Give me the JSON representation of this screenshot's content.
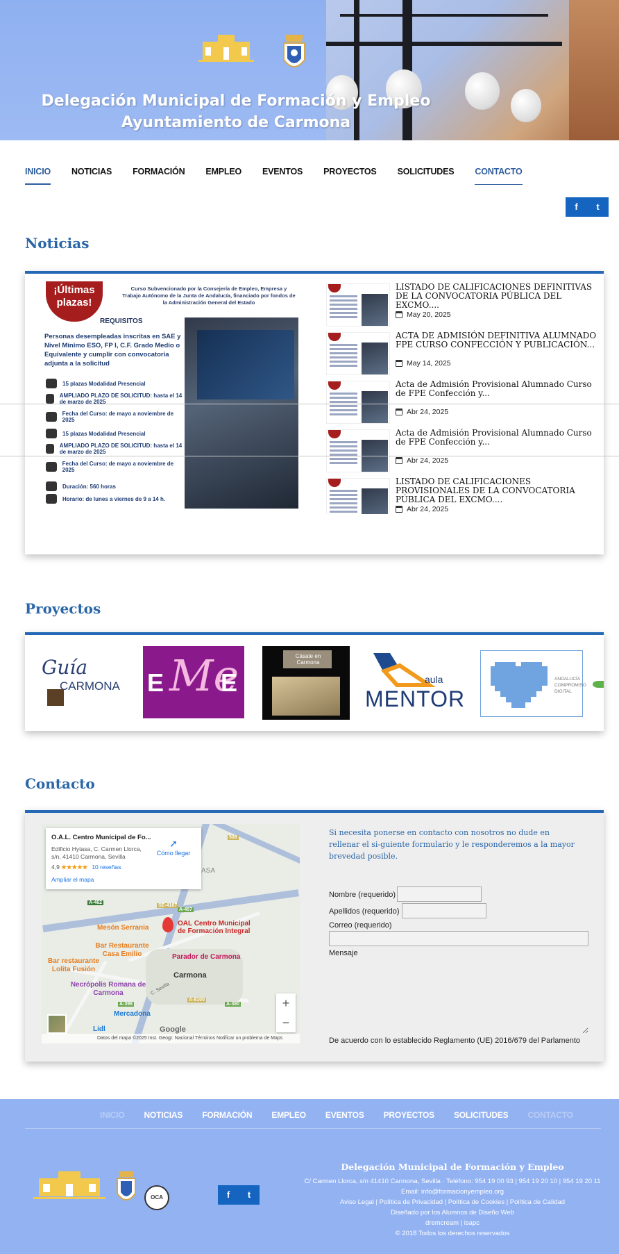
{
  "header": {
    "title_line1": "Delegación Municipal de Formación y Empleo",
    "title_line2": "Ayuntamiento de Carmona"
  },
  "nav": {
    "items": [
      "INICIO",
      "NOTICIAS",
      "FORMACIÓN",
      "EMPLEO",
      "EVENTOS",
      "PROYECTOS",
      "SOLICITUDES",
      "CONTACTO"
    ],
    "active": "INICIO"
  },
  "social": {
    "facebook": "f",
    "twitter": "t"
  },
  "noticias": {
    "heading": "Noticias",
    "featured": {
      "badge": "¡Últimas plazas!",
      "subtitle": "Curso Subvencionado por la Consejería de Empleo, Empresa y Trabajo Autónomo de la Junta de Andalucía, financiado por fondos de la Administración General del Estado",
      "requisitos": "REQUISITOS",
      "personas": "Personas desempleadas inscritas en SAE y Nivel Mínimo ESO, FP I, C.F. Grado Medio o Equivalente y cumplir con convocatoria adjunta a la solicitud",
      "rows": [
        "15 plazas Modalidad Presencial",
        "AMPLIADO PLAZO DE SOLICITUD: hasta el 14 de marzo de 2025",
        "Fecha del Curso: de mayo a noviembre de 2025",
        "15 plazas Modalidad Presencial",
        "AMPLIADO PLAZO DE SOLICITUD: hasta el 14 de marzo de 2025",
        "Fecha del Curso: de mayo a noviembre de 2025",
        "Duración: 560 horas",
        "Horario: de lunes a viernes de 9 a 14 h."
      ]
    },
    "items": [
      {
        "title": "LISTADO DE CALIFICACIONES DEFINITIVAS DE LA CONVOCATORIA PÚBLICA DEL EXCMO....",
        "date": "May 20, 2025"
      },
      {
        "title": "ACTA DE ADMISIÓN DEFINITIVA ALUMNADO FPE CURSO CONFECCIÓN Y PUBLICACIÓN...",
        "date": "May 14, 2025"
      },
      {
        "title": "Acta de Admisión Provisional Alumnado Curso de FPE Confección y...",
        "date": "Abr 24, 2025"
      },
      {
        "title": "Acta de Admisión Provisional Alumnado Curso de FPE Confección y...",
        "date": "Abr 24, 2025"
      },
      {
        "title": "LISTADO DE CALIFICACIONES PROVISIONALES DE LA CONVOCATORIA PÚBLICA DEL EXCMO....",
        "date": "Abr 24, 2025"
      }
    ]
  },
  "proyectos": {
    "heading": "Proyectos",
    "logos": [
      {
        "name": "Guía Carmona",
        "text1": "Guía",
        "text2": "CARMONA"
      },
      {
        "name": "eMe",
        "text1": "E",
        "text2": "Me",
        "text3": "E"
      },
      {
        "name": "Cásate en Carmona",
        "text1": "Cásate en Carmona"
      },
      {
        "name": "Aula Mentor",
        "text1": "aula",
        "text2": "MENTOR"
      },
      {
        "name": "Andalucía Compromiso Digital",
        "text1": "ANDALUCÍA",
        "text2": "COMPROMISO",
        "text3": "DIGITAL"
      }
    ]
  },
  "contacto": {
    "heading": "Contacto",
    "map": {
      "place_name": "O.A.L. Centro Municipal de Fo...",
      "address": "Edificio Hytasa, C. Carmen Llorca, s/n, 41410 Carmona, Sevilla",
      "rating": "4,9",
      "stars": "★★★★★",
      "reviews": "10 reseñas",
      "directions": "Cómo llegar",
      "enlarge": "Ampliar el mapa",
      "labels": {
        "pin": "OAL Centro Municipal de Formación Integral",
        "meson": "Mesón Serrania",
        "bar1": "Bar Restaurante Casa Emilio",
        "bar2": "Bar restaurante Lolita Fusión",
        "parador": "Parador de Carmona",
        "carmona": "Carmona",
        "necropolis": "Necrópolis Romana de Carmona",
        "mercadona": "Mercadona",
        "lidl": "Lidl",
        "asa": "ASA",
        "se4107": "SE-4107",
        "a457": "A-457",
        "a462": "A-462",
        "a398": "A-398",
        "a380": "A-380",
        "a8100": "A-8100",
        "n508": "508",
        "csevilla": "C. Sevilla",
        "google": "Google"
      },
      "footer": "Datos del mapa ©2025 Inst. Geogr. Nacional   Términos   Notificar un problema de Maps",
      "zoom_in": "+",
      "zoom_out": "−"
    },
    "form": {
      "intro": "Si necesita ponerse en contacto con nosotros no dude en rellenar el si-guiente formulario y le responderemos a la mayor brevedad posible.",
      "nombre": "Nombre (requerido)",
      "apellidos": "Apellidos (requerido)",
      "correo": "Correo (requerido)",
      "mensaje": "Mensaje",
      "legal": "De acuerdo con lo establecido Reglamento (UE) 2016/679 del Parlamento"
    }
  },
  "footer": {
    "nav": [
      "INICIO",
      "NOTICIAS",
      "FORMACIÓN",
      "EMPLEO",
      "EVENTOS",
      "PROYECTOS",
      "SOLICITUDES",
      "CONTACTO"
    ],
    "title": "Delegación Municipal de Formación y Empleo",
    "address": "C/ Carmen Llorca, s/n 41410 Carmona, Sevilla · Teléfono: 954 19 00 93 | 954 19 20 10 | 954 19 20 11",
    "email": "Email: info@formacionyempleo.org",
    "legal": "Aviso Legal | Política de Privacidad | Política de Cookies | Política de Calidad",
    "design": "Diseñado por los Alumnos de Diseño Web",
    "authors": "dremcream | isapc",
    "copyright": "© 2018 Todos los derechos reservados",
    "seal_text": "OCA"
  }
}
